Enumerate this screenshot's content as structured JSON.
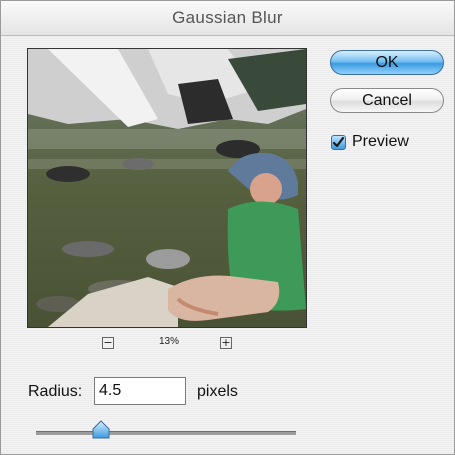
{
  "dialog": {
    "title": "Gaussian Blur"
  },
  "buttons": {
    "ok_label": "OK",
    "cancel_label": "Cancel"
  },
  "preview_checkbox": {
    "label": "Preview",
    "checked": true
  },
  "zoom": {
    "minus_icon": "−",
    "plus_icon": "+",
    "level": "13%"
  },
  "radius": {
    "label": "Radius:",
    "value": "4.5",
    "units": "pixels",
    "slider_fraction": 0.25
  },
  "colors": {
    "ok_accent": "#3e9be0",
    "checkbox_accent": "#3e9be0"
  }
}
